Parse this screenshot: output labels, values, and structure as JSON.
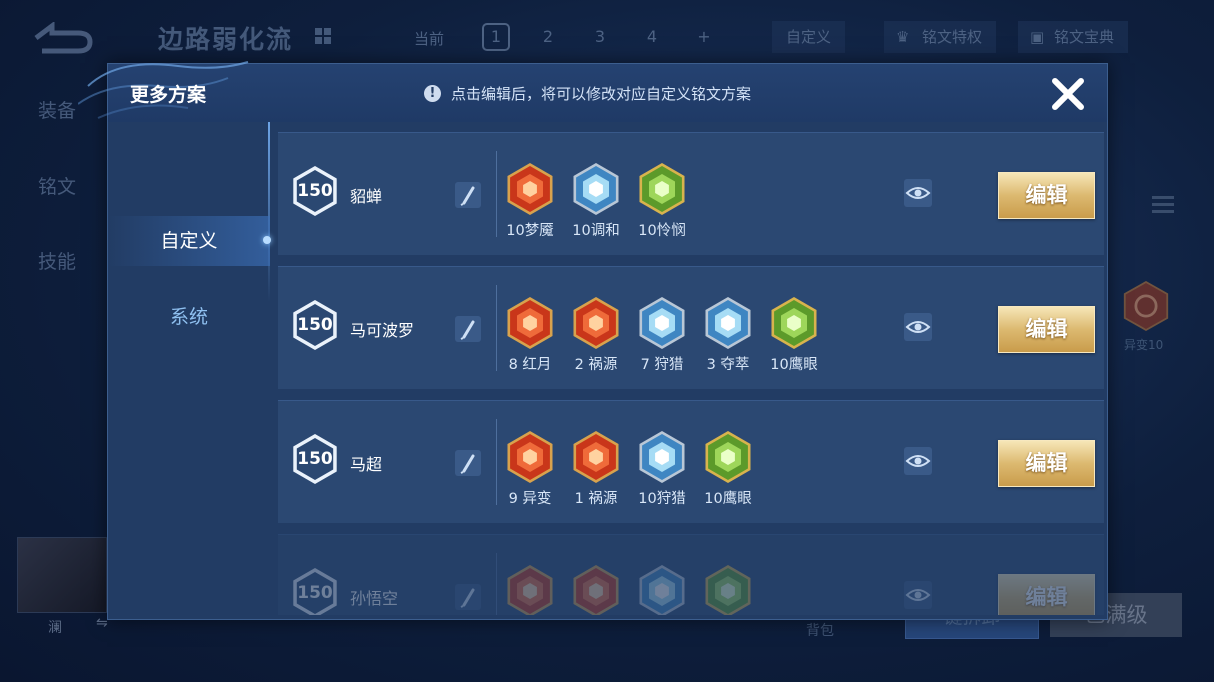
{
  "background": {
    "title": "边路弱化流",
    "current_label": "当前",
    "pages": [
      "1",
      "2",
      "3",
      "4",
      "+"
    ],
    "custom_label": "自定义",
    "rune_privilege_label": "铭文特权",
    "rune_codex_label": "铭文宝典",
    "side_tabs": [
      "装备",
      "铭文",
      "技能"
    ],
    "right_rune_label": "异变10",
    "hero_name": "澜",
    "swap_symbol": "⇋",
    "bag_label": "背包",
    "btn_partial": "键拆卸",
    "btn_full": "已满级"
  },
  "modal": {
    "title": "更多方案",
    "notice": "点击编辑后，将可以修改对应自定义铭文方案",
    "close_icon": "close-x-icon",
    "sidebar": {
      "active": "自定义",
      "inactive": "系统"
    },
    "plans": [
      {
        "level": "150",
        "name": "貂蝉",
        "edit_label": "编辑",
        "runes": [
          {
            "label": "10梦魇",
            "color": "red",
            "icon": "nightmare-rune-icon"
          },
          {
            "label": "10调和",
            "color": "blue",
            "icon": "harmony-rune-icon"
          },
          {
            "label": "10怜悯",
            "color": "green",
            "icon": "compassion-rune-icon"
          }
        ]
      },
      {
        "level": "150",
        "name": "马可波罗",
        "edit_label": "编辑",
        "runes": [
          {
            "label": "8 红月",
            "color": "red",
            "icon": "red-moon-rune-icon"
          },
          {
            "label": "2 祸源",
            "color": "red",
            "icon": "calamity-rune-icon"
          },
          {
            "label": "7 狩猎",
            "color": "blue",
            "icon": "hunt-rune-icon"
          },
          {
            "label": "3 夺萃",
            "color": "blue",
            "icon": "plunder-rune-icon"
          },
          {
            "label": "10鹰眼",
            "color": "green",
            "icon": "hawk-eye-rune-icon"
          }
        ]
      },
      {
        "level": "150",
        "name": "马超",
        "edit_label": "编辑",
        "runes": [
          {
            "label": "9 异变",
            "color": "red",
            "icon": "mutation-rune-icon"
          },
          {
            "label": "1 祸源",
            "color": "red",
            "icon": "calamity-rune-icon"
          },
          {
            "label": "10狩猎",
            "color": "blue",
            "icon": "hunt-rune-icon"
          },
          {
            "label": "10鹰眼",
            "color": "green",
            "icon": "hawk-eye-rune-icon"
          }
        ]
      },
      {
        "level": "150",
        "name": "孙悟空",
        "edit_label": "编辑",
        "runes": [
          {
            "label": "",
            "color": "red",
            "icon": "red-rune-icon"
          },
          {
            "label": "",
            "color": "red",
            "icon": "red-rune-icon"
          },
          {
            "label": "",
            "color": "blue",
            "icon": "blue-rune-icon"
          },
          {
            "label": "",
            "color": "green",
            "icon": "green-rune-icon"
          }
        ]
      }
    ]
  },
  "colors": {
    "modal_bg": "#223c64",
    "row_bg": "#2b4872",
    "gold_button": "#dcb970",
    "rune_red": "#d9441f",
    "rune_blue": "#7ec8ef",
    "rune_green": "#7fc23c"
  }
}
